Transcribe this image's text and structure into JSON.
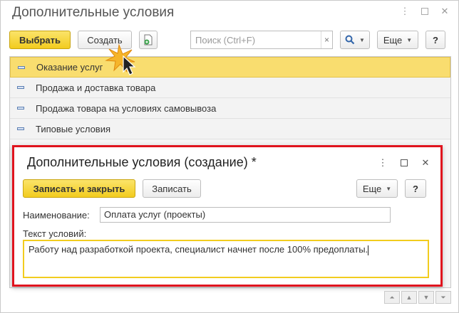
{
  "window": {
    "title": "Дополнительные условия"
  },
  "toolbar": {
    "select_label": "Выбрать",
    "create_label": "Создать",
    "search_placeholder": "Поиск (Ctrl+F)",
    "clear_glyph": "×",
    "more_label": "Еще",
    "help_label": "?"
  },
  "list": {
    "items": [
      {
        "label": "Оказание услуг",
        "selected": true
      },
      {
        "label": "Продажа и доставка товара",
        "selected": false
      },
      {
        "label": "Продажа товара на условиях самовывоза",
        "selected": false
      },
      {
        "label": "Типовые условия",
        "selected": false
      }
    ]
  },
  "dialog": {
    "title": "Дополнительные условия (создание) *",
    "write_close_label": "Записать и закрыть",
    "write_label": "Записать",
    "more_label": "Еще",
    "help_label": "?",
    "name_label": "Наименование:",
    "name_value": "Оплата услуг (проекты)",
    "terms_label": "Текст условий:",
    "terms_value": "Работу над разработкой проекта, специалист начнет после 100% предоплаты."
  },
  "colors": {
    "accent_yellow": "#f2cc1e",
    "selection": "#f9dd6f",
    "highlight_red": "#e0141e"
  }
}
